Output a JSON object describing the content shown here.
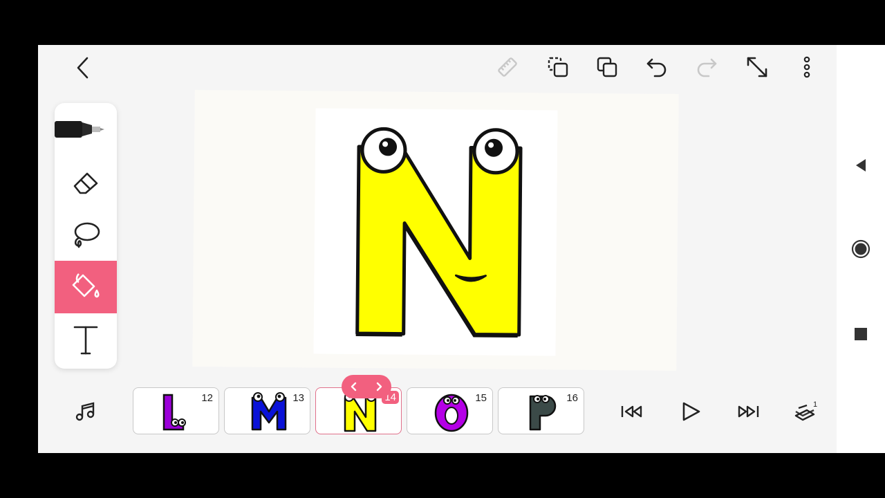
{
  "app": {
    "accent": "#f2607f",
    "background": "#f5f5f5"
  },
  "toolbar": {
    "icons": [
      "back-icon",
      "ruler-icon",
      "duplicate-frame-icon",
      "copy-icon",
      "undo-icon",
      "redo-icon",
      "fullscreen-icon",
      "more-icon"
    ]
  },
  "tools": [
    {
      "name": "pen-tool",
      "icon": "pen-icon",
      "selected": false
    },
    {
      "name": "eraser-tool",
      "icon": "eraser-icon",
      "selected": false
    },
    {
      "name": "lasso-tool",
      "icon": "lasso-icon",
      "selected": false
    },
    {
      "name": "fill-tool",
      "icon": "paint-bucket-icon",
      "selected": true
    },
    {
      "name": "text-tool",
      "icon": "text-icon",
      "selected": false
    }
  ],
  "canvas": {
    "letter": "N",
    "letter_color": "#ffff00"
  },
  "timeline": {
    "frames": [
      {
        "number": "12",
        "letter": "L",
        "color": "#9b00d9",
        "selected": false
      },
      {
        "number": "13",
        "letter": "M",
        "color": "#0a12d8",
        "selected": false
      },
      {
        "number": "14",
        "letter": "N",
        "color": "#ffff00",
        "selected": true
      },
      {
        "number": "15",
        "letter": "O",
        "color": "#b400e6",
        "selected": false
      },
      {
        "number": "16",
        "letter": "P",
        "color": "#3b4a48",
        "selected": false
      }
    ]
  },
  "playback": {
    "icons": [
      "music-icon",
      "skip-start-icon",
      "play-icon",
      "skip-end-icon",
      "onion-skin-icon"
    ],
    "onion_skin_count": "1"
  },
  "system_nav": {
    "icons": [
      "back-triangle-icon",
      "home-circle-icon",
      "recents-square-icon"
    ]
  }
}
